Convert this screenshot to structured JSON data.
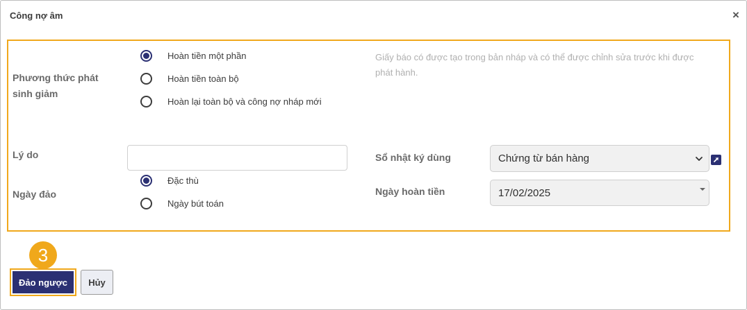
{
  "dialog": {
    "title": "Công nợ âm",
    "close_icon": "close-icon"
  },
  "form": {
    "method": {
      "label": "Phương thức phát sinh giảm",
      "options": [
        {
          "label": "Hoàn tiền một phần",
          "checked": true
        },
        {
          "label": "Hoàn tiền toàn bộ",
          "checked": false
        },
        {
          "label": "Hoàn lại toàn bộ và công nợ nháp mới",
          "checked": false
        }
      ],
      "hint": "Giấy báo có được tạo trong bản nháp và có thể được chỉnh sửa trước khi được phát hành."
    },
    "reason": {
      "label": "Lý do",
      "value": ""
    },
    "reverse_date": {
      "label": "Ngày đảo",
      "options": [
        {
          "label": "Đặc thù",
          "checked": true
        },
        {
          "label": "Ngày bút toán",
          "checked": false
        }
      ]
    },
    "journal": {
      "label": "Sổ nhật ký dùng",
      "value": "Chứng từ bán hàng",
      "external_link_icon": "external-link-icon"
    },
    "refund_date": {
      "label": "Ngày hoàn tiền",
      "value": "17/02/2025"
    }
  },
  "step_badge": "3",
  "buttons": {
    "reverse": "Đảo ngược",
    "cancel": "Hủy"
  },
  "colors": {
    "primary": "#2b3073",
    "highlight": "#f0a81b",
    "hint_text": "#b0b0b0"
  }
}
